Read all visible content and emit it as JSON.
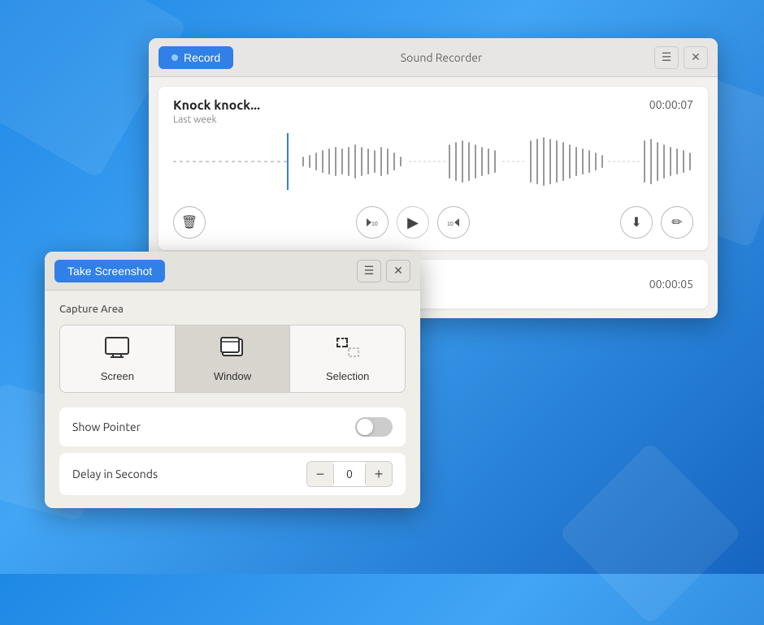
{
  "background": {
    "color": "#2196f3"
  },
  "sound_recorder": {
    "title": "Sound Recorder",
    "record_button": "Record",
    "menu_icon": "☰",
    "close_icon": "✕",
    "recording": {
      "title": "Knock knock...",
      "date": "Last week",
      "duration": "00:00:07"
    },
    "recording2": {
      "duration": "00:00:05"
    },
    "controls": {
      "skip_back": "⟨10",
      "play": "▶",
      "skip_forward": "10⟩",
      "delete_label": "delete",
      "download_label": "download",
      "edit_label": "edit"
    }
  },
  "screenshot_window": {
    "title": "Take Screenshot",
    "menu_icon": "☰",
    "close_icon": "✕",
    "capture_area_label": "Capture Area",
    "options": [
      {
        "id": "screen",
        "label": "Screen",
        "icon": "🖥"
      },
      {
        "id": "window",
        "label": "Window",
        "icon": "⊟",
        "active": true
      },
      {
        "id": "selection",
        "label": "Selection",
        "icon": "⊞"
      }
    ],
    "show_pointer": {
      "label": "Show Pointer",
      "enabled": false
    },
    "delay": {
      "label": "Delay in Seconds",
      "value": "0",
      "minus": "−",
      "plus": "+"
    }
  }
}
